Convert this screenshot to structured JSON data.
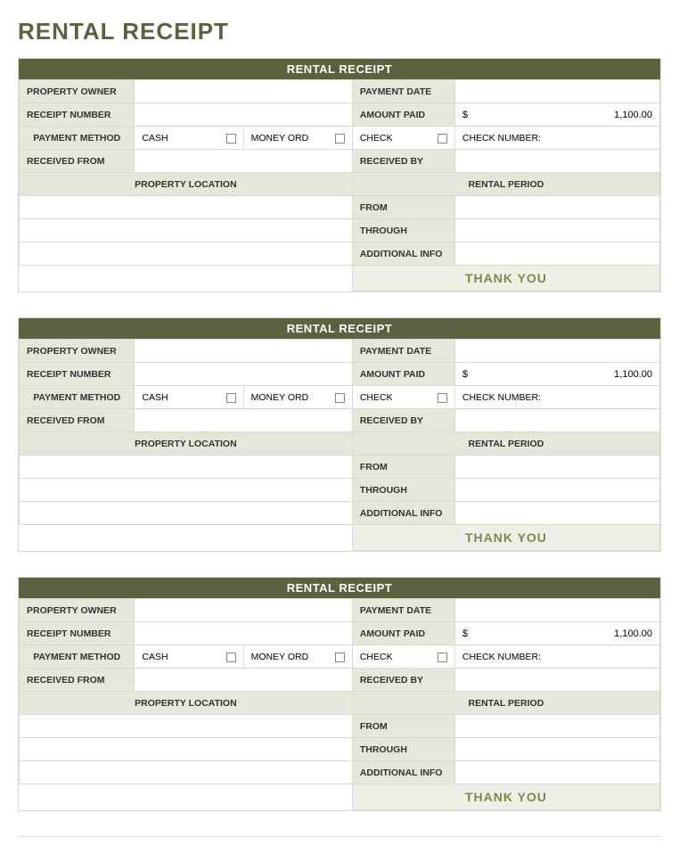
{
  "title": "RENTAL RECEIPT",
  "labels": {
    "header": "RENTAL RECEIPT",
    "property_owner": "PROPERTY OWNER",
    "payment_date": "PAYMENT DATE",
    "receipt_number": "RECEIPT NUMBER",
    "amount_paid": "AMOUNT PAID",
    "payment_method": "PAYMENT METHOD",
    "cash": "CASH",
    "money_ord": "MONEY ORD",
    "check": "CHECK",
    "check_number": "CHECK NUMBER:",
    "received_from": "RECEIVED FROM",
    "received_by": "RECEIVED BY",
    "property_location": "PROPERTY LOCATION",
    "rental_period": "RENTAL PERIOD",
    "from": "FROM",
    "through": "THROUGH",
    "additional_info": "ADDITIONAL INFO",
    "thank_you": "THANK YOU"
  },
  "receipts": [
    {
      "property_owner": "",
      "payment_date": "",
      "receipt_number": "",
      "amount_currency": "$",
      "amount_value": "1,100.00",
      "check_number": "",
      "received_from": "",
      "received_by": "",
      "property_location_1": "",
      "property_location_2": "",
      "property_location_3": "",
      "from": "",
      "through": "",
      "additional_info": ""
    },
    {
      "property_owner": "",
      "payment_date": "",
      "receipt_number": "",
      "amount_currency": "$",
      "amount_value": "1,100.00",
      "check_number": "",
      "received_from": "",
      "received_by": "",
      "property_location_1": "",
      "property_location_2": "",
      "property_location_3": "",
      "from": "",
      "through": "",
      "additional_info": ""
    },
    {
      "property_owner": "",
      "payment_date": "",
      "receipt_number": "",
      "amount_currency": "$",
      "amount_value": "1,100.00",
      "check_number": "",
      "received_from": "",
      "received_by": "",
      "property_location_1": "",
      "property_location_2": "",
      "property_location_3": "",
      "from": "",
      "through": "",
      "additional_info": ""
    }
  ]
}
